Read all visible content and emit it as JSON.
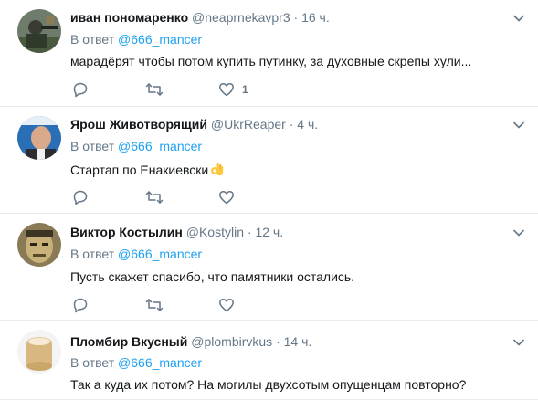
{
  "tweets": [
    {
      "name": "иван пономаренко",
      "handle": "@neaprnekavpr3",
      "sep": "·",
      "time": "16 ч.",
      "reply_prefix": "В ответ",
      "reply_to": "@666_mancer",
      "text": "марадёрят чтобы потом купить  путинку, за духовные скрепы хули...",
      "like_count": "1",
      "avatar_icon": "soldier-avatar"
    },
    {
      "name": "Ярош Животворящий",
      "handle": "@UkrReaper",
      "sep": "·",
      "time": "4 ч.",
      "reply_prefix": "В ответ",
      "reply_to": "@666_mancer",
      "text": "Стартап по Енакиевски",
      "like_count": "",
      "avatar_icon": "man-portrait-avatar",
      "emoji_icon": "ok-hand-emoji"
    },
    {
      "name": "Виктор Костылин",
      "handle": "@Kostylin",
      "sep": "·",
      "time": "12 ч.",
      "reply_prefix": "В ответ",
      "reply_to": "@666_mancer",
      "text": "Пусть скажет спасибо, что памятники остались.",
      "like_count": "",
      "avatar_icon": "drawn-face-avatar"
    },
    {
      "name": "Пломбир Вкусный",
      "handle": "@plombirvkus",
      "sep": "·",
      "time": "14 ч.",
      "reply_prefix": "В ответ",
      "reply_to": "@666_mancer",
      "text": "Так а куда их потом? На могилы двухсотым опущенцам повторно?",
      "like_count": "",
      "avatar_icon": "ice-cream-avatar"
    }
  ],
  "icons": {
    "reply": "reply-icon",
    "retweet": "retweet-icon",
    "like": "like-icon",
    "more": "chevron-down-icon"
  },
  "colors": {
    "link": "#1da1f2",
    "secondary": "#657786",
    "text": "#14171a",
    "divider": "#e6ecf0"
  }
}
